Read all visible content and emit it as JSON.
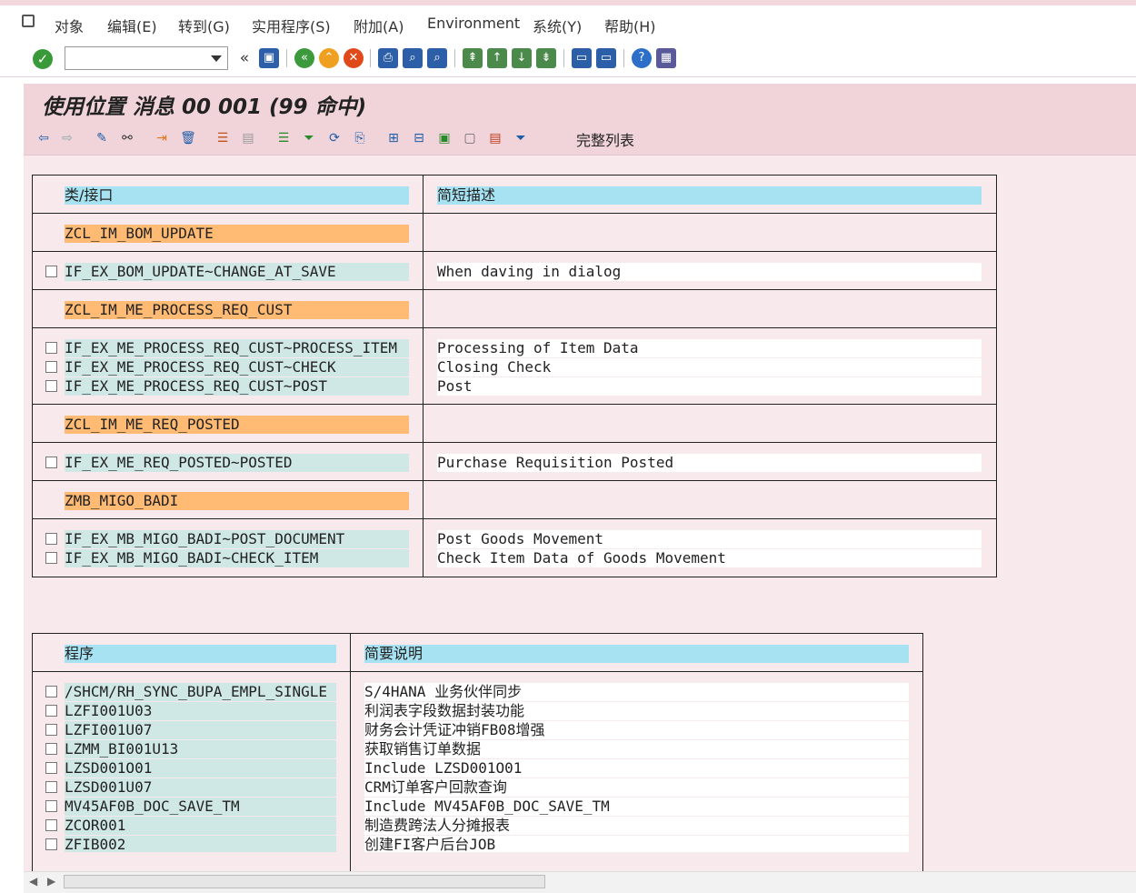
{
  "menu": [
    "对象",
    "编辑(E)",
    "转到(G)",
    "实用程序(S)",
    "附加(A)",
    "Environment",
    "系统(Y)",
    "帮助(H)"
  ],
  "title": "使用位置 消息 00 001 (99 命中)",
  "toolbar2": {
    "full_list_label": "完整列表"
  },
  "classes": {
    "header": {
      "col1": "类/接口",
      "col2": "简短描述"
    },
    "groups": [
      {
        "class": "ZCL_IM_BOM_UPDATE",
        "items": [
          {
            "method": "IF_EX_BOM_UPDATE~CHANGE_AT_SAVE",
            "desc": "When daving in dialog"
          }
        ]
      },
      {
        "class": "ZCL_IM_ME_PROCESS_REQ_CUST",
        "items": [
          {
            "method": "IF_EX_ME_PROCESS_REQ_CUST~PROCESS_ITEM",
            "desc": "Processing of Item Data"
          },
          {
            "method": "IF_EX_ME_PROCESS_REQ_CUST~CHECK",
            "desc": "Closing Check"
          },
          {
            "method": "IF_EX_ME_PROCESS_REQ_CUST~POST",
            "desc": "Post"
          }
        ]
      },
      {
        "class": "ZCL_IM_ME_REQ_POSTED",
        "items": [
          {
            "method": "IF_EX_ME_REQ_POSTED~POSTED",
            "desc": "Purchase Requisition Posted"
          }
        ]
      },
      {
        "class": "ZMB_MIGO_BADI",
        "items": [
          {
            "method": "IF_EX_MB_MIGO_BADI~POST_DOCUMENT",
            "desc": "Post Goods Movement"
          },
          {
            "method": "IF_EX_MB_MIGO_BADI~CHECK_ITEM",
            "desc": "Check Item Data of Goods Movement"
          }
        ]
      }
    ]
  },
  "programs": {
    "header": {
      "col1": "程序",
      "col2": "简要说明"
    },
    "rows": [
      {
        "name": "/SHCM/RH_SYNC_BUPA_EMPL_SINGLE",
        "desc": "S/4HANA 业务伙伴同步"
      },
      {
        "name": "LZFI001U03",
        "desc": "利润表字段数据封装功能"
      },
      {
        "name": "LZFI001U07",
        "desc": "财务会计凭证冲销FB08增强"
      },
      {
        "name": "LZMM_BI001U13",
        "desc": "获取销售订单数据"
      },
      {
        "name": "LZSD001O01",
        "desc": "Include LZSD001O01"
      },
      {
        "name": "LZSD001U07",
        "desc": "CRM订单客户回款查询"
      },
      {
        "name": "MV45AF0B_DOC_SAVE_TM",
        "desc": "Include MV45AF0B_DOC_SAVE_TM"
      },
      {
        "name": "ZCOR001",
        "desc": "制造费跨法人分摊报表"
      },
      {
        "name": "ZFIB002",
        "desc": "创建FI客户后台JOB"
      }
    ]
  }
}
